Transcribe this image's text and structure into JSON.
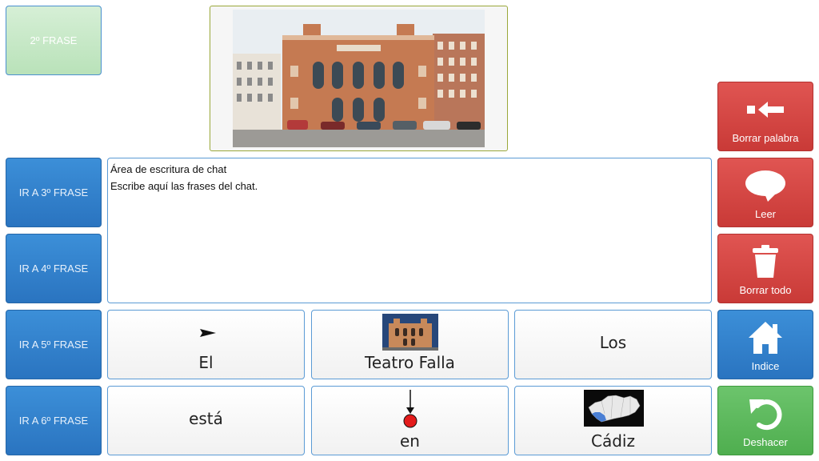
{
  "left_buttons": {
    "frase2": "2º FRASE",
    "frase3": "IR A 3º FRASE",
    "frase4": "IR A 4º FRASE",
    "frase5": "IR A 5º FRASE",
    "frase6": "IR A 6º FRASE"
  },
  "chat": {
    "line1": "Área de escritura de chat",
    "line2": "Escribe aquí las frases del chat."
  },
  "grid": {
    "el": "El",
    "teatro_falla": "Teatro Falla",
    "los": "Los",
    "esta": "está",
    "en": "en",
    "cadiz": "Cádiz"
  },
  "right_buttons": {
    "borrar_palabra": "Borrar palabra",
    "leer": "Leer",
    "borrar_todo": "Borrar todo",
    "indice": "Indice",
    "deshacer": "Deshacer"
  },
  "icons": {
    "borrar_palabra": "backspace-arrow-icon",
    "leer": "speech-bubble-icon",
    "borrar_todo": "trash-icon",
    "indice": "home-icon",
    "deshacer": "undo-icon",
    "el": "arrow-pointer-icon",
    "en": "down-arrow-dot-icon",
    "cadiz": "andalusia-map-icon"
  },
  "colors": {
    "blue": "#2a74c0",
    "red": "#c93a37",
    "green": "#4fae4f",
    "light_green": "#c6e8c6",
    "border_blue": "#5b9bd5"
  }
}
